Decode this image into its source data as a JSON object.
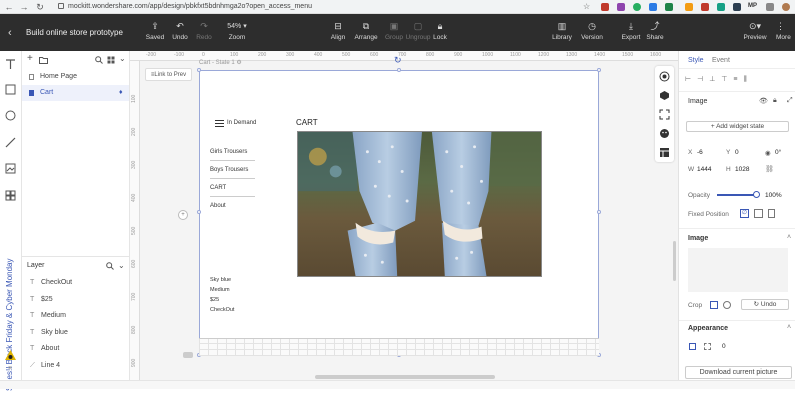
{
  "browser": {
    "url": "mockitt.wondershare.com/app/design/pbkfxt5bdnhmga2o?open_access_menu",
    "profile_label": "MP"
  },
  "toolbar": {
    "project_title": "Build online store prototype",
    "saved": "Saved",
    "undo": "Undo",
    "redo": "Redo",
    "zoom_value": "54%",
    "zoom": "Zoom",
    "align": "Align",
    "arrange": "Arrange",
    "group": "Group",
    "ungroup": "Ungroup",
    "lock": "Lock",
    "library": "Library",
    "version": "Version",
    "export": "Export",
    "share": "Share",
    "preview": "Preview",
    "more": "More"
  },
  "promo": {
    "text": "Sales!! Black Friday & Cyber Monday"
  },
  "pages": {
    "items": [
      {
        "label": "Home Page",
        "active": false
      },
      {
        "label": "Cart",
        "active": true
      }
    ]
  },
  "layer": {
    "title": "Layer",
    "items": [
      {
        "label": "CheckOut",
        "icon": "text-icon"
      },
      {
        "label": "$25",
        "icon": "text-icon"
      },
      {
        "label": "Medium",
        "icon": "text-icon"
      },
      {
        "label": "Sky blue",
        "icon": "text-icon"
      },
      {
        "label": "About",
        "icon": "text-icon"
      },
      {
        "label": "Line 4",
        "icon": "line-icon"
      }
    ]
  },
  "canvas": {
    "artboard_label": "Cart - State 1",
    "link_prev": "≡Link to Prev",
    "ruler_top": [
      "-200",
      "-100",
      "0",
      "100",
      "200",
      "300",
      "400",
      "500",
      "600",
      "700",
      "800",
      "900",
      "1000",
      "1100",
      "1200",
      "1300",
      "1400",
      "1500",
      "1600"
    ],
    "ruler_left": [
      "100",
      "200",
      "300",
      "400",
      "500",
      "600",
      "700",
      "800",
      "900"
    ]
  },
  "artboard": {
    "brand": "In Demand",
    "menu": [
      "Girls Trousers",
      "Boys Trousers",
      "CART",
      "About"
    ],
    "title": "CART",
    "details": [
      "Sky blue",
      "Medium",
      "$25",
      "CheckOut"
    ]
  },
  "right_panel": {
    "tab_style": "Style",
    "tab_event": "Event",
    "section_image": "Image",
    "add_state": "+ Add widget state",
    "x_label": "X",
    "x_value": "-6",
    "y_label": "Y",
    "y_value": "0",
    "rotation": "0°",
    "w_label": "W",
    "w_value": "1444",
    "h_label": "H",
    "h_value": "1028",
    "opacity_label": "Opacity",
    "opacity_value": "100%",
    "opacity_level": 1.0,
    "fixed_position": "Fixed Position",
    "image_section": "Image",
    "crop_label": "Crop",
    "undo_btn": "Undo",
    "appearance": "Appearance",
    "appearance_value": "0",
    "download": "Download current picture"
  },
  "colors": {
    "accent": "#3a57b5",
    "toolbar_bg": "#2d2d2d"
  }
}
